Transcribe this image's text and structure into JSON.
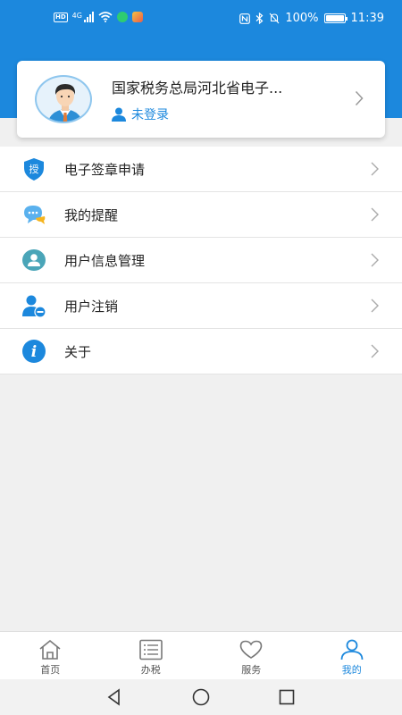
{
  "status": {
    "network": "4G",
    "battery": "100%",
    "time": "11:39"
  },
  "profile": {
    "org_name": "国家税务总局河北省电子...",
    "login_status": "未登录"
  },
  "menu": [
    {
      "label": "电子签章申请",
      "icon": "authorize-shield-icon",
      "icon_text": "授"
    },
    {
      "label": "我的提醒",
      "icon": "chat-bubble-icon"
    },
    {
      "label": "用户信息管理",
      "icon": "user-info-icon"
    },
    {
      "label": "用户注销",
      "icon": "user-remove-icon"
    },
    {
      "label": "关于",
      "icon": "info-icon",
      "icon_text": "i"
    }
  ],
  "tabs": [
    {
      "label": "首页",
      "icon": "home-icon"
    },
    {
      "label": "办税",
      "icon": "list-icon"
    },
    {
      "label": "服务",
      "icon": "heart-icon"
    },
    {
      "label": "我的",
      "icon": "user-icon",
      "active": true
    }
  ],
  "colors": {
    "primary": "#1c88dd",
    "background": "#f0f0f0"
  }
}
